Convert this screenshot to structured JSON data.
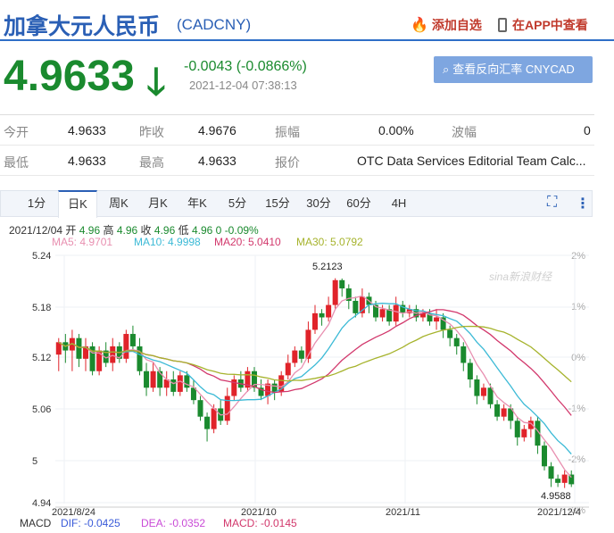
{
  "header": {
    "title": "加拿大元人民币",
    "code": "(CADCNY)",
    "favorite": "添加自选",
    "app": "在APP中查看"
  },
  "quote": {
    "price": "4.9633",
    "change": "-0.0043 (-0.0866%)",
    "time": "2021-12-04 07:38:13",
    "reverse_button": "查看反向汇率 CNYCAD",
    "colors": {
      "down": "#1a8a2e",
      "up": "#e0232a",
      "accent": "#2a5fb5"
    }
  },
  "stats": {
    "row1": [
      {
        "label": "今开",
        "value": "4.9633"
      },
      {
        "label": "昨收",
        "value": "4.9676"
      },
      {
        "label": "振幅",
        "value": "0.00%"
      },
      {
        "label": "波幅",
        "value": "0"
      }
    ],
    "row2": [
      {
        "label": "最低",
        "value": "4.9633"
      },
      {
        "label": "最高",
        "value": "4.9633"
      },
      {
        "label": "报价",
        "value": "OTC Data Services Editorial Team Calc..."
      }
    ]
  },
  "tabs": [
    "1分",
    "日K",
    "周K",
    "月K",
    "年K",
    "5分",
    "15分",
    "30分",
    "60分",
    "4H"
  ],
  "active_tab": "日K",
  "ohlc": {
    "date": "2021/12/04",
    "open_label": "开",
    "open": "4.96",
    "high_label": "高",
    "high": "4.96",
    "close_label": "收",
    "close": "4.96",
    "low_label": "低",
    "low": "4.96",
    "vol": "0",
    "pct": "-0.09%"
  },
  "ma": {
    "ma5": "MA5: 4.9701",
    "ma10": "MA10: 4.9998",
    "ma20": "MA20: 5.0410",
    "ma30": "MA30: 5.0792"
  },
  "macd": {
    "label": "MACD",
    "dif": "DIF: -0.0425",
    "dea": "DEA: -0.0352",
    "macd": "MACD: -0.0145"
  },
  "chart_data": {
    "type": "candlestick",
    "y_ticks": [
      "5.24",
      "5.18",
      "5.12",
      "5.06",
      "5",
      "4.94"
    ],
    "pct_ticks": [
      "2%",
      "1%",
      "0%",
      "-1%",
      "-2%",
      "-3%"
    ],
    "x_ticks": [
      "2021/8/24",
      "2021/10",
      "2021/11",
      "2021/12/4"
    ],
    "ylim": [
      4.94,
      5.24
    ],
    "high_annotation": "5.2123",
    "low_annotation": "4.9588",
    "watermark": "sina新浪财经",
    "candles": [
      [
        5.12,
        5.135,
        5.14,
        5.1
      ],
      [
        5.135,
        5.125,
        5.145,
        5.11
      ],
      [
        5.125,
        5.14,
        5.15,
        5.1
      ],
      [
        5.14,
        5.115,
        5.145,
        5.105
      ],
      [
        5.115,
        5.13,
        5.14,
        5.1
      ],
      [
        5.13,
        5.1,
        5.135,
        5.095
      ],
      [
        5.1,
        5.125,
        5.13,
        5.095
      ],
      [
        5.125,
        5.11,
        5.135,
        5.105
      ],
      [
        5.11,
        5.13,
        5.14,
        5.1
      ],
      [
        5.13,
        5.115,
        5.135,
        5.11
      ],
      [
        5.115,
        5.145,
        5.15,
        5.11
      ],
      [
        5.145,
        5.13,
        5.155,
        5.125
      ],
      [
        5.13,
        5.1,
        5.14,
        5.095
      ],
      [
        5.1,
        5.08,
        5.11,
        5.07
      ],
      [
        5.08,
        5.1,
        5.11,
        5.075
      ],
      [
        5.1,
        5.08,
        5.105,
        5.07
      ],
      [
        5.08,
        5.09,
        5.1,
        5.07
      ],
      [
        5.09,
        5.075,
        5.1,
        5.07
      ],
      [
        5.075,
        5.095,
        5.1,
        5.07
      ],
      [
        5.095,
        5.08,
        5.1,
        5.075
      ],
      [
        5.08,
        5.065,
        5.09,
        5.06
      ],
      [
        5.065,
        5.045,
        5.07,
        5.04
      ],
      [
        5.045,
        5.03,
        5.05,
        5.015
      ],
      [
        5.03,
        5.055,
        5.06,
        5.025
      ],
      [
        5.055,
        5.04,
        5.065,
        5.035
      ],
      [
        5.04,
        5.07,
        5.08,
        5.035
      ],
      [
        5.07,
        5.09,
        5.095,
        5.065
      ],
      [
        5.09,
        5.08,
        5.1,
        5.075
      ],
      [
        5.08,
        5.1,
        5.105,
        5.075
      ],
      [
        5.1,
        5.08,
        5.105,
        5.075
      ],
      [
        5.08,
        5.07,
        5.09,
        5.065
      ],
      [
        5.07,
        5.085,
        5.09,
        5.06
      ],
      [
        5.085,
        5.075,
        5.09,
        5.065
      ],
      [
        5.075,
        5.095,
        5.1,
        5.07
      ],
      [
        5.095,
        5.11,
        5.12,
        5.09
      ],
      [
        5.11,
        5.125,
        5.13,
        5.105
      ],
      [
        5.125,
        5.115,
        5.13,
        5.11
      ],
      [
        5.115,
        5.15,
        5.16,
        5.11
      ],
      [
        5.15,
        5.17,
        5.18,
        5.145
      ],
      [
        5.17,
        5.165,
        5.175,
        5.155
      ],
      [
        5.165,
        5.18,
        5.19,
        5.16
      ],
      [
        5.18,
        5.21,
        5.2123,
        5.175
      ],
      [
        5.21,
        5.2,
        5.212,
        5.19
      ],
      [
        5.2,
        5.185,
        5.205,
        5.175
      ],
      [
        5.185,
        5.17,
        5.19,
        5.165
      ],
      [
        5.17,
        5.19,
        5.2,
        5.165
      ],
      [
        5.19,
        5.18,
        5.195,
        5.17
      ],
      [
        5.18,
        5.165,
        5.185,
        5.16
      ],
      [
        5.165,
        5.175,
        5.18,
        5.16
      ],
      [
        5.175,
        5.16,
        5.18,
        5.155
      ],
      [
        5.16,
        5.18,
        5.19,
        5.155
      ],
      [
        5.18,
        5.17,
        5.185,
        5.165
      ],
      [
        5.17,
        5.175,
        5.18,
        5.165
      ],
      [
        5.175,
        5.165,
        5.18,
        5.16
      ],
      [
        5.165,
        5.17,
        5.175,
        5.16
      ],
      [
        5.17,
        5.16,
        5.175,
        5.155
      ],
      [
        5.16,
        5.165,
        5.175,
        5.15
      ],
      [
        5.165,
        5.15,
        5.17,
        5.14
      ],
      [
        5.15,
        5.14,
        5.155,
        5.13
      ],
      [
        5.14,
        5.13,
        5.145,
        5.12
      ],
      [
        5.13,
        5.11,
        5.135,
        5.1
      ],
      [
        5.11,
        5.09,
        5.115,
        5.08
      ],
      [
        5.09,
        5.07,
        5.095,
        5.06
      ],
      [
        5.07,
        5.08,
        5.085,
        5.065
      ],
      [
        5.08,
        5.06,
        5.085,
        5.055
      ],
      [
        5.06,
        5.045,
        5.065,
        5.04
      ],
      [
        5.045,
        5.055,
        5.06,
        5.04
      ],
      [
        5.055,
        5.04,
        5.06,
        5.03
      ],
      [
        5.04,
        5.02,
        5.045,
        5.01
      ],
      [
        5.02,
        5.03,
        5.035,
        5.015
      ],
      [
        5.03,
        5.04,
        5.045,
        5.02
      ],
      [
        5.04,
        5.01,
        5.045,
        5.0
      ],
      [
        5.01,
        4.985,
        5.015,
        4.98
      ],
      [
        4.985,
        4.97,
        4.99,
        4.96
      ],
      [
        4.97,
        4.965,
        4.975,
        4.96
      ],
      [
        4.965,
        4.975,
        4.98,
        4.9588
      ],
      [
        4.975,
        4.9633,
        4.98,
        4.96
      ]
    ],
    "ma_lines": {
      "MA5": {
        "color": "#e88fb0"
      },
      "MA10": {
        "color": "#3cbad6"
      },
      "MA20": {
        "color": "#d2386c"
      },
      "MA30": {
        "color": "#a6b32c"
      }
    }
  }
}
